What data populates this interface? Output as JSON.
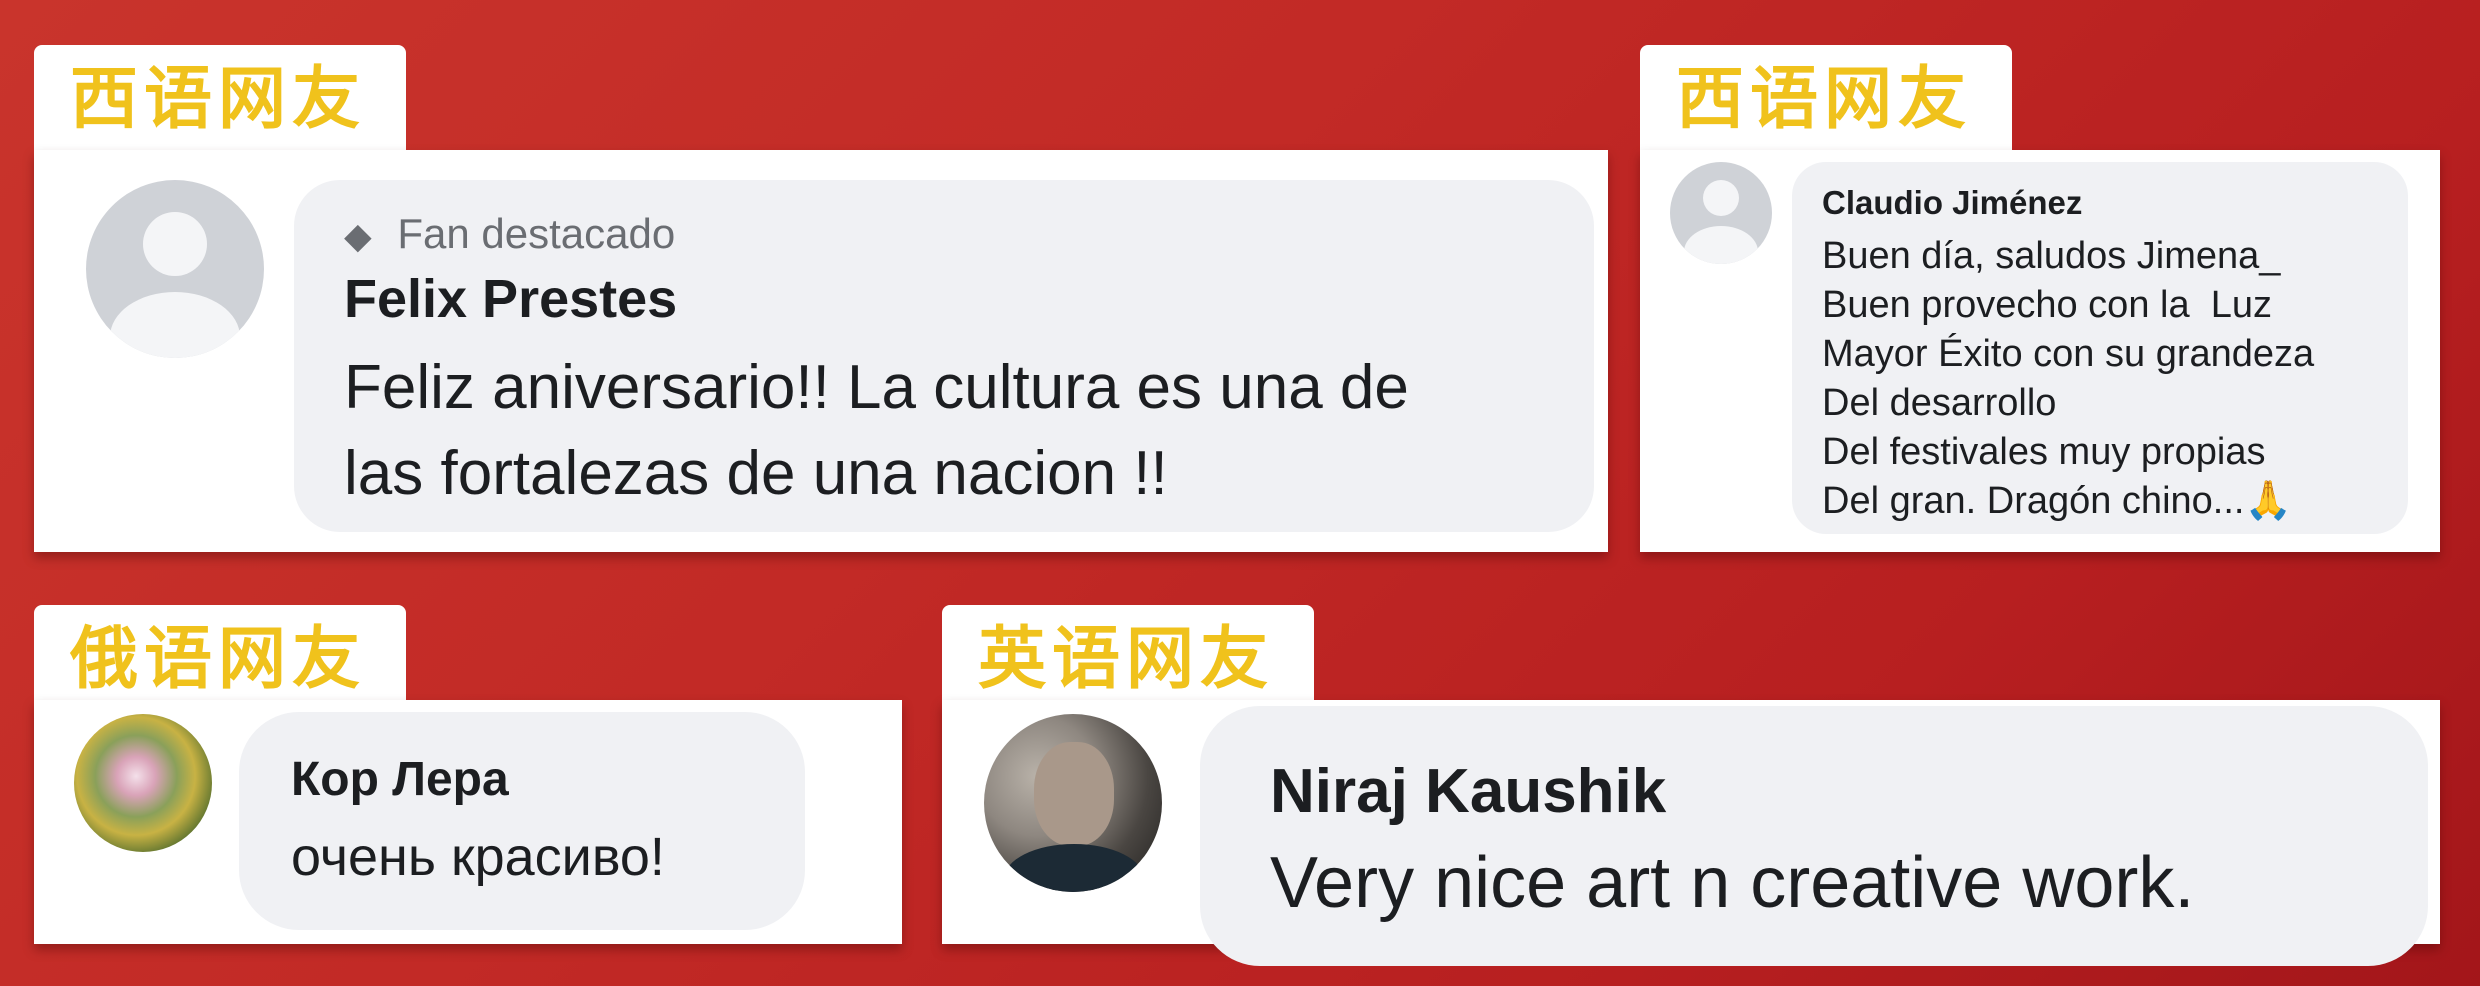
{
  "tags": {
    "spanish_1": "西语网友",
    "spanish_2": "西语网友",
    "russian": "俄语网友",
    "english": "英语网友"
  },
  "comment_1": {
    "badge": "Fan destacado",
    "author": "Felix Prestes",
    "lines": [
      "Feliz aniversario!! La cultura es una de",
      "las fortalezas de una nacion !!"
    ]
  },
  "comment_2": {
    "author": "Claudio Jiménez",
    "lines": [
      "Buen día, saludos Jimena_",
      "Buen provecho con la  Luz",
      "Mayor Éxito con su grandeza",
      "Del desarrollo",
      "Del festivales muy propias",
      "Del gran. Dragón chino...🙏"
    ]
  },
  "comment_3": {
    "author": "Кор Лера",
    "text": "очень красиво!"
  },
  "comment_4": {
    "author": "Niraj Kaushik",
    "text": "Very nice art n creative work."
  },
  "colors": {
    "background": "#c22a26",
    "tag_text": "#f0c21c",
    "bubble": "#f0f1f4",
    "avatar_placeholder": "#cfd2d7"
  }
}
